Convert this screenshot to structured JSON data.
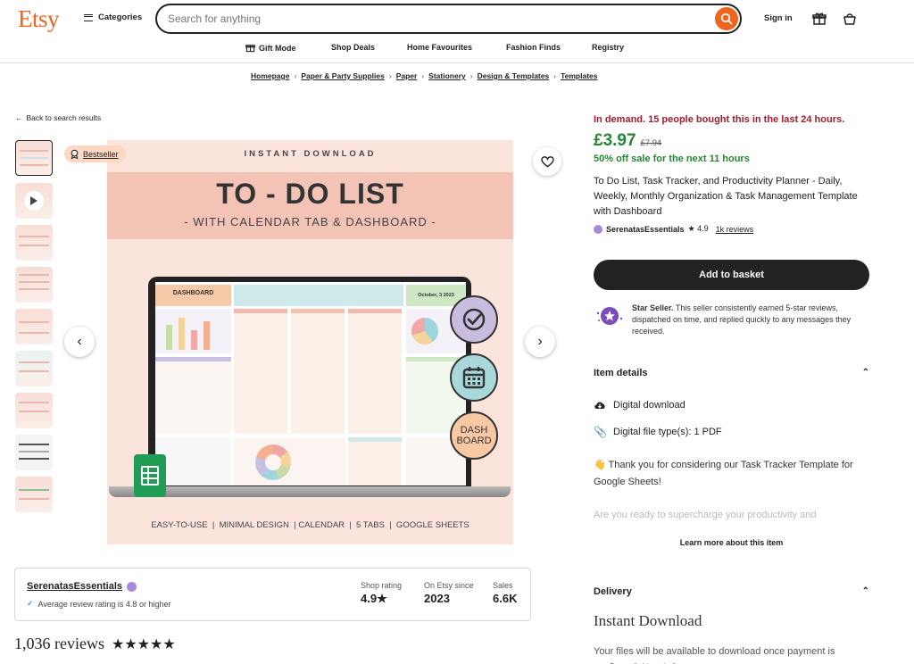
{
  "header": {
    "logo": "Etsy",
    "categories_label": "Categories",
    "search_placeholder": "Search for anything",
    "signin_label": "Sign in"
  },
  "subnav": [
    "Gift Mode",
    "Shop Deals",
    "Home Favourites",
    "Fashion Finds",
    "Registry"
  ],
  "breadcrumbs": [
    "Homepage",
    "Paper & Party Supplies",
    "Paper",
    "Stationery",
    "Design & Templates",
    "Templates"
  ],
  "back_label": "Back to search results",
  "badge_bestseller": "Bestseller",
  "hero": {
    "top_text": "INSTANT DOWNLOAD",
    "title": "TO - DO LIST",
    "subtitle": "- WITH CALENDAR TAB & DASHBOARD -",
    "footer": "EASY-TO-USE  |  MINIMAL DESIGN  | CALENDAR  |  5 TABS  |  GOOGLE SHEETS",
    "dash_label_1": "DASH",
    "dash_label_2": "BOARD",
    "screen_title": "DASHBOARD",
    "screen_date": "October, 3 2023"
  },
  "shop": {
    "name": "SerenatasEssentials",
    "review_note": "Average review rating is 4.8 or higher",
    "stats": [
      {
        "label": "Shop rating",
        "value": "4.9★"
      },
      {
        "label": "On Etsy since",
        "value": "2023"
      },
      {
        "label": "Sales",
        "value": "6.6K"
      }
    ]
  },
  "reviews_heading": "1,036 reviews",
  "reviews_stars": "★★★★★",
  "product": {
    "demand": "In demand. 15 people bought this in the last 24 hours.",
    "price": "£3.97",
    "original_price": "£7.94",
    "sale": "50% off sale for the next 11 hours",
    "title": "To Do List, Task Tracker, and Productivity Planner - Daily, Weekly, Monthly Organization & Task Management Template with Dashboard",
    "seller": "SerenatasEssentials",
    "rating": "★ 4.9",
    "review_count": "1k reviews",
    "add_to_basket": "Add to basket",
    "star_seller_bold": "Star Seller.",
    "star_seller_text": "This seller consistently earned 5-star reviews, dispatched on time, and replied quickly to any messages they received."
  },
  "item_details": {
    "heading": "Item details",
    "rows": [
      "Digital download",
      "Digital file type(s): 1 PDF"
    ],
    "desc_1": "👋 Thank you for considering our Task Tracker Template for Google Sheets!",
    "desc_2": "Are you ready to supercharge your productivity and",
    "learn_more": "Learn more about this item"
  },
  "delivery": {
    "heading": "Delivery",
    "title": "Instant Download",
    "text": "Your files will be available to download once payment is confirmed. Here's how"
  },
  "colors": {
    "accent": "#f1641e",
    "demand": "#a61a2e",
    "price": "#258635",
    "star_purple": "#7b4bb7"
  }
}
